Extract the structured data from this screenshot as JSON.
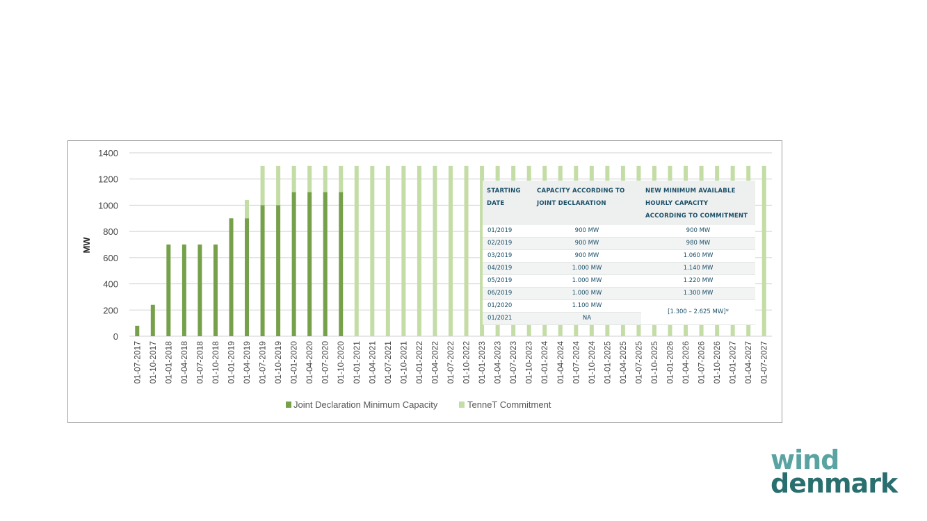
{
  "chart_data": {
    "type": "bar",
    "ylabel": "MW",
    "xlabel": "",
    "ylim": [
      0,
      1400
    ],
    "yticks": [
      0,
      200,
      400,
      600,
      800,
      1000,
      1200,
      1400
    ],
    "grid": true,
    "legend_position": "bottom",
    "categories": [
      "01-07-2017",
      "01-10-2017",
      "01-01-2018",
      "01-04-2018",
      "01-07-2018",
      "01-10-2018",
      "01-01-2019",
      "01-04-2019",
      "01-07-2019",
      "01-10-2019",
      "01-01-2020",
      "01-04-2020",
      "01-07-2020",
      "01-10-2020",
      "01-01-2021",
      "01-04-2021",
      "01-07-2021",
      "01-10-2021",
      "01-01-2022",
      "01-04-2022",
      "01-07-2022",
      "01-10-2022",
      "01-01-2023",
      "01-04-2023",
      "01-07-2023",
      "01-10-2023",
      "01-01-2024",
      "01-04-2024",
      "01-07-2024",
      "01-10-2024",
      "01-01-2025",
      "01-04-2025",
      "01-07-2025",
      "01-10-2025",
      "01-01-2026",
      "01-04-2026",
      "01-07-2026",
      "01-10-2026",
      "01-01-2027",
      "01-04-2027",
      "01-07-2027"
    ],
    "series": [
      {
        "name": "Joint Declaration Minimum Capacity",
        "color": "#76a14a",
        "values": [
          80,
          240,
          700,
          700,
          700,
          700,
          900,
          900,
          1000,
          1000,
          1100,
          1100,
          1100,
          1100,
          0,
          0,
          0,
          0,
          0,
          0,
          0,
          0,
          0,
          0,
          0,
          0,
          0,
          0,
          0,
          0,
          0,
          0,
          0,
          0,
          0,
          0,
          0,
          0,
          0,
          0,
          0
        ]
      },
      {
        "name": "TenneT Commitment",
        "color": "#c4dda6",
        "values": [
          0,
          0,
          0,
          0,
          0,
          0,
          900,
          1040,
          1300,
          1300,
          1300,
          1300,
          1300,
          1300,
          1300,
          1300,
          1300,
          1300,
          1300,
          1300,
          1300,
          1300,
          1300,
          1300,
          1300,
          1300,
          1300,
          1300,
          1300,
          1300,
          1300,
          1300,
          1300,
          1300,
          1300,
          1300,
          1300,
          1300,
          1300,
          1300,
          1300
        ]
      }
    ]
  },
  "table": {
    "headers": [
      "STARTING DATE",
      "CAPACITY ACCORDING TO JOINT DECLARATION",
      "NEW MINIMUM AVAILABLE HOURLY CAPACITY ACCORDING TO COMMITMENT"
    ],
    "rows": [
      {
        "date": "01/2019",
        "joint": "900 MW",
        "commit": "900 MW"
      },
      {
        "date": "02/2019",
        "joint": "900 MW",
        "commit": "980 MW"
      },
      {
        "date": "03/2019",
        "joint": "900 MW",
        "commit": "1.060 MW"
      },
      {
        "date": "04/2019",
        "joint": "1.000 MW",
        "commit": "1.140 MW"
      },
      {
        "date": "05/2019",
        "joint": "1.000 MW",
        "commit": "1.220 MW"
      },
      {
        "date": "06/2019",
        "joint": "1.000 MW",
        "commit": "1.300 MW"
      },
      {
        "date": "01/2020",
        "joint": "1.100 MW",
        "commit": "[1.300 – 2.625 MW]*"
      },
      {
        "date": "01/2021",
        "joint": "NA",
        "commit": ""
      }
    ]
  },
  "logo": {
    "line1": "wind",
    "line2": "denmark"
  }
}
